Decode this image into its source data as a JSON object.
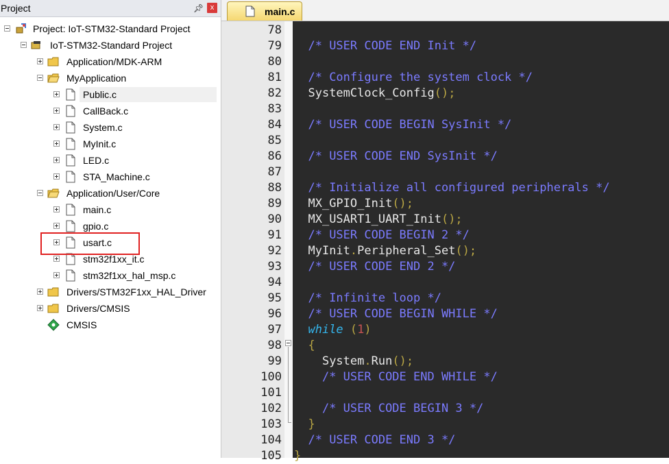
{
  "panel": {
    "title": "Project",
    "pin_icon": "pin-icon",
    "close_label": "x"
  },
  "tree": {
    "root": "Project: IoT-STM32-Standard Project",
    "target": "IoT-STM32-Standard Project",
    "groups": {
      "mdk": "Application/MDK-ARM",
      "myapp": "MyApplication",
      "core": "Application/User/Core",
      "hal": "Drivers/STM32F1xx_HAL_Driver",
      "cmsis_group": "Drivers/CMSIS",
      "cmsis": "CMSIS"
    },
    "myapp_files": [
      "Public.c",
      "CallBack.c",
      "System.c",
      "MyInit.c",
      "LED.c",
      "STA_Machine.c"
    ],
    "core_files": [
      "main.c",
      "gpio.c",
      "usart.c",
      "stm32f1xx_it.c",
      "stm32f1xx_hal_msp.c"
    ]
  },
  "editor": {
    "tab_label": "main.c",
    "line_numbers": [
      "78",
      "79",
      "80",
      "81",
      "82",
      "83",
      "84",
      "85",
      "86",
      "87",
      "88",
      "89",
      "90",
      "91",
      "92",
      "93",
      "94",
      "95",
      "96",
      "97",
      "98",
      "99",
      "100",
      "101",
      "102",
      "103",
      "104",
      "105"
    ],
    "code": {
      "l79": "/* USER CODE END Init */",
      "l81": "/* Configure the system clock */",
      "l82_fn": "SystemClock_Config",
      "l82_p": "();",
      "l84": "/* USER CODE BEGIN SysInit */",
      "l86": "/* USER CODE END SysInit */",
      "l88": "/* Initialize all configured peripherals */",
      "l89_fn": "MX_GPIO_Init",
      "l89_p": "();",
      "l90_fn": "MX_USART1_UART_Init",
      "l90_p": "();",
      "l91": "/* USER CODE BEGIN 2 */",
      "l92_obj": "MyInit",
      "l92_dot": ".",
      "l92_fn": "Peripheral_Set",
      "l92_p": "();",
      "l93": "/* USER CODE END 2 */",
      "l95": "/* Infinite loop */",
      "l96": "/* USER CODE BEGIN WHILE */",
      "l97_kw": "while",
      "l97_open": " (",
      "l97_num": "1",
      "l97_close": ")",
      "l98": "{",
      "l99_obj": "System",
      "l99_dot": ".",
      "l99_fn": "Run",
      "l99_p": "();",
      "l100": "/* USER CODE END WHILE */",
      "l102": "/* USER CODE BEGIN 3 */",
      "l103": "}",
      "l104": "/* USER CODE END 3 */",
      "l105": "}"
    }
  }
}
